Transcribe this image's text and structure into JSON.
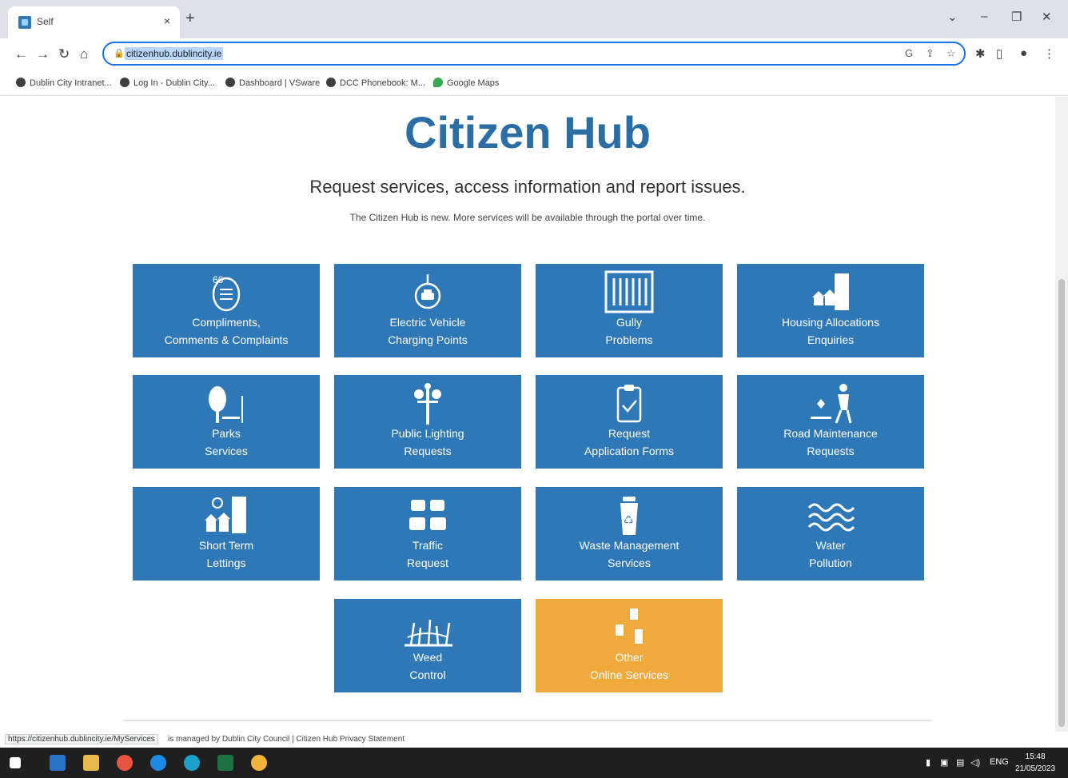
{
  "browser": {
    "tab_title": "Self",
    "tab_close": "×",
    "new_tab": "+",
    "url": "citizenhub.dublincity.ie",
    "window_controls": [
      "⌄",
      "–",
      "❐",
      "✕"
    ]
  },
  "bookmarks": [
    "Dublin City Intranet...",
    "Log In - Dublin City...",
    "Dashboard | VSware",
    "DCC Phonebook: M...",
    "Google Maps"
  ],
  "page": {
    "title": "Citizen Hub",
    "subtitle": "Request services, access information and report issues.",
    "note": "The Citizen Hub is new. More services will be available through the portal over time."
  },
  "tiles": [
    {
      "line1": "Compliments,",
      "line2": "Comments & Complaints",
      "icon": "speech-bubble-icon",
      "color": "#2f78b7"
    },
    {
      "line1": "Electric Vehicle",
      "line2": "Charging Points",
      "icon": "ev-charging-icon",
      "color": "#2f78b7"
    },
    {
      "line1": "Gully",
      "line2": "Problems",
      "icon": "drain-grate-icon",
      "color": "#2f78b7"
    },
    {
      "line1": "Housing Allocations",
      "line2": "Enquiries",
      "icon": "housing-icon",
      "color": "#2f78b7"
    },
    {
      "line1": "Parks",
      "line2": "Services",
      "icon": "tree-bench-icon",
      "color": "#2f78b7"
    },
    {
      "line1": "Public Lighting",
      "line2": "Requests",
      "icon": "street-light-icon",
      "color": "#2f78b7"
    },
    {
      "line1": "Request",
      "line2": "Application Forms",
      "icon": "clipboard-check-icon",
      "color": "#2f78b7"
    },
    {
      "line1": "Road Maintenance",
      "line2": "Requests",
      "icon": "road-worker-icon",
      "color": "#2f78b7"
    },
    {
      "line1": "Short Term",
      "line2": "Lettings",
      "icon": "short-term-housing-icon",
      "color": "#2f78b7"
    },
    {
      "line1": "Traffic",
      "line2": "Request",
      "icon": "traffic-cars-icon",
      "color": "#2f78b7"
    },
    {
      "line1": "Waste Management",
      "line2": "Services",
      "icon": "recycle-bin-icon",
      "color": "#2f78b7"
    },
    {
      "line1": "Water",
      "line2": "Pollution",
      "icon": "water-waves-icon",
      "color": "#2f78b7"
    },
    {
      "line1": "Weed",
      "line2": "Control",
      "icon": "weed-grass-icon",
      "color": "#2f78b7"
    },
    {
      "line1": "Other",
      "line2": "Online Services",
      "icon": "castle-towers-icon",
      "color": "#f0a93b"
    }
  ],
  "status": {
    "hover_url": "https://citizenhub.dublincity.ie/MyServices",
    "footer_text": "is managed by Dublin City Council  |  Citizen Hub Privacy Statement"
  },
  "taskbar": {
    "tray": "ENG",
    "time": "15:48",
    "date": "21/05/2023"
  }
}
